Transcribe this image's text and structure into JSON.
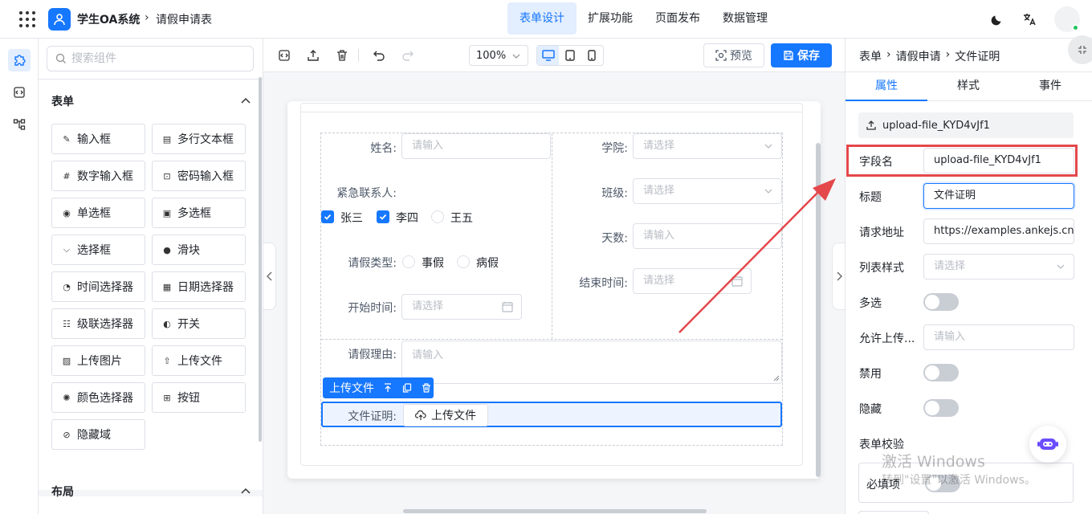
{
  "header": {
    "app_title": "学生OA系统",
    "crumb_sep": "›",
    "page_name": "请假申请表",
    "nav": [
      "表单设计",
      "扩展功能",
      "页面发布",
      "数据管理"
    ]
  },
  "components": {
    "search_placeholder": "搜索组件",
    "form_section": "表单",
    "layout_section": "布局",
    "items": [
      "输入框",
      "多行文本框",
      "数字输入框",
      "密码输入框",
      "单选框",
      "多选框",
      "选择框",
      "滑块",
      "时间选择器",
      "日期选择器",
      "级联选择器",
      "开关",
      "上传图片",
      "上传文件",
      "颜色选择器",
      "按钮",
      "隐藏域"
    ],
    "item_icons": [
      "edit-icon",
      "textarea-icon",
      "number-icon",
      "lock-icon",
      "radio-icon",
      "checkbox-icon",
      "select-icon",
      "slider-icon",
      "clock-icon",
      "calendar-icon",
      "cascader-icon",
      "switch-icon",
      "image-icon",
      "upload-icon",
      "palette-icon",
      "button-icon",
      "eye-off-icon"
    ]
  },
  "toolbar": {
    "zoom": "100%",
    "preview": "预览",
    "save": "保存"
  },
  "form": {
    "name_label": "姓名:",
    "name_ph": "请输入",
    "college_label": "学院:",
    "college_ph": "请选择",
    "contact_label": "紧急联系人:",
    "contacts": [
      "张三",
      "李四",
      "王五"
    ],
    "class_label": "班级:",
    "class_ph": "请选择",
    "days_label": "天数:",
    "days_ph": "请输入",
    "leave_type_label": "请假类型:",
    "leave_types": [
      "事假",
      "病假"
    ],
    "end_label": "结束时间:",
    "end_ph": "请选择",
    "start_label": "开始时间:",
    "start_ph": "请选择",
    "reason_label": "请假理由:",
    "reason_ph": "请输入",
    "sel_title": "上传文件",
    "file_label": "文件证明:",
    "upload_btn": "上传文件"
  },
  "props": {
    "crumbs": [
      "表单",
      "›",
      "请假申请",
      "›",
      "文件证明"
    ],
    "tabs": [
      "属性",
      "样式",
      "事件"
    ],
    "component_id": "upload-file_KYD4vJf1",
    "field_name_label": "字段名",
    "field_name_value": "upload-file_KYD4vJf1",
    "title_label": "标题",
    "title_value": "文件证明",
    "url_label": "请求地址",
    "url_value": "https://examples.ankejs.cn,",
    "list_style_label": "列表样式",
    "list_style_ph": "请选择",
    "multi_label": "多选",
    "allow_label": "允许上传...",
    "allow_ph": "请输入",
    "disabled_label": "禁用",
    "hidden_label": "隐藏",
    "validate_label": "表单校验",
    "required_label": "必填项"
  },
  "watermark": {
    "line1": "激活 Windows",
    "line2": "转到\"设置\"以激活 Windows。"
  },
  "colors": {
    "primary": "#1677ff",
    "highlight": "#e4484b"
  }
}
